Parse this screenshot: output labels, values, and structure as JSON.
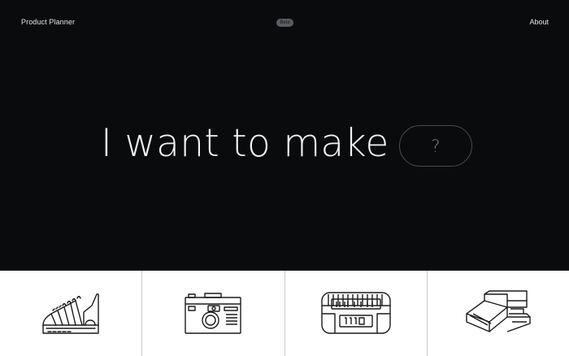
{
  "header": {
    "brand": "Product Planner",
    "badge": "Beta",
    "about": "About"
  },
  "hero": {
    "headline": "I want to make",
    "input_placeholder": "?"
  },
  "products": [
    {
      "icon": "keyboard-icon"
    },
    {
      "icon": "camera-icon"
    },
    {
      "icon": "radio-icon"
    },
    {
      "icon": "box-icon"
    }
  ],
  "colors": {
    "background": "#0a0b0d",
    "tiles": "#ffffff",
    "line": "#1a1a1a"
  }
}
